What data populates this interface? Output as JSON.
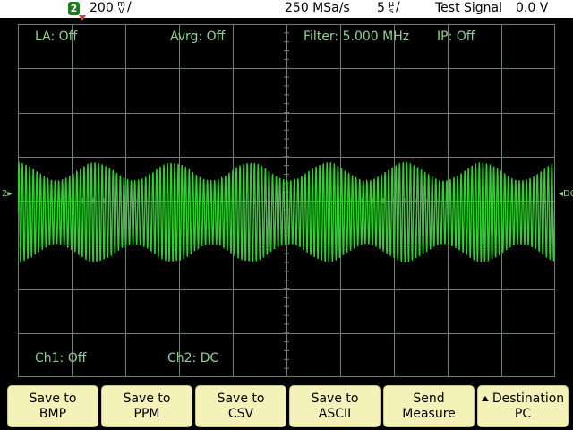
{
  "status": {
    "channel_number": "2",
    "vertical_scale_value": "200",
    "vertical_scale_unit_top": "m",
    "vertical_scale_unit_bottom": "V",
    "sample_rate": "250 MSa/s",
    "time_scale_value": "5",
    "time_scale_unit_top": "µ",
    "time_scale_unit_bottom": "s",
    "test_signal": "Test Signal",
    "test_signal_value": "0.0 V"
  },
  "overlay": {
    "la": "LA: Off",
    "avrg": "Avrg: Off",
    "filter": "Filter: 5.000 MHz",
    "ip": "IP: Off",
    "ch1": "Ch1: Off",
    "ch2": "Ch2: DC"
  },
  "markers": {
    "left_channel": "2",
    "right_level": "DC"
  },
  "softkeys": [
    {
      "line1": "Save to",
      "line2": "BMP"
    },
    {
      "line1": "Save to",
      "line2": "PPM"
    },
    {
      "line1": "Save to",
      "line2": "CSV"
    },
    {
      "line1": "Save to",
      "line2": "ASCII"
    },
    {
      "line1": "Send",
      "line2": "Measure"
    },
    {
      "line1": "Destination",
      "line2": "PC"
    }
  ],
  "colors": {
    "trace": "#2fd12f",
    "grid": "#6f7f6f",
    "overlay_text": "#8fd08f",
    "softkey_bg": "#f4f2b8"
  }
}
